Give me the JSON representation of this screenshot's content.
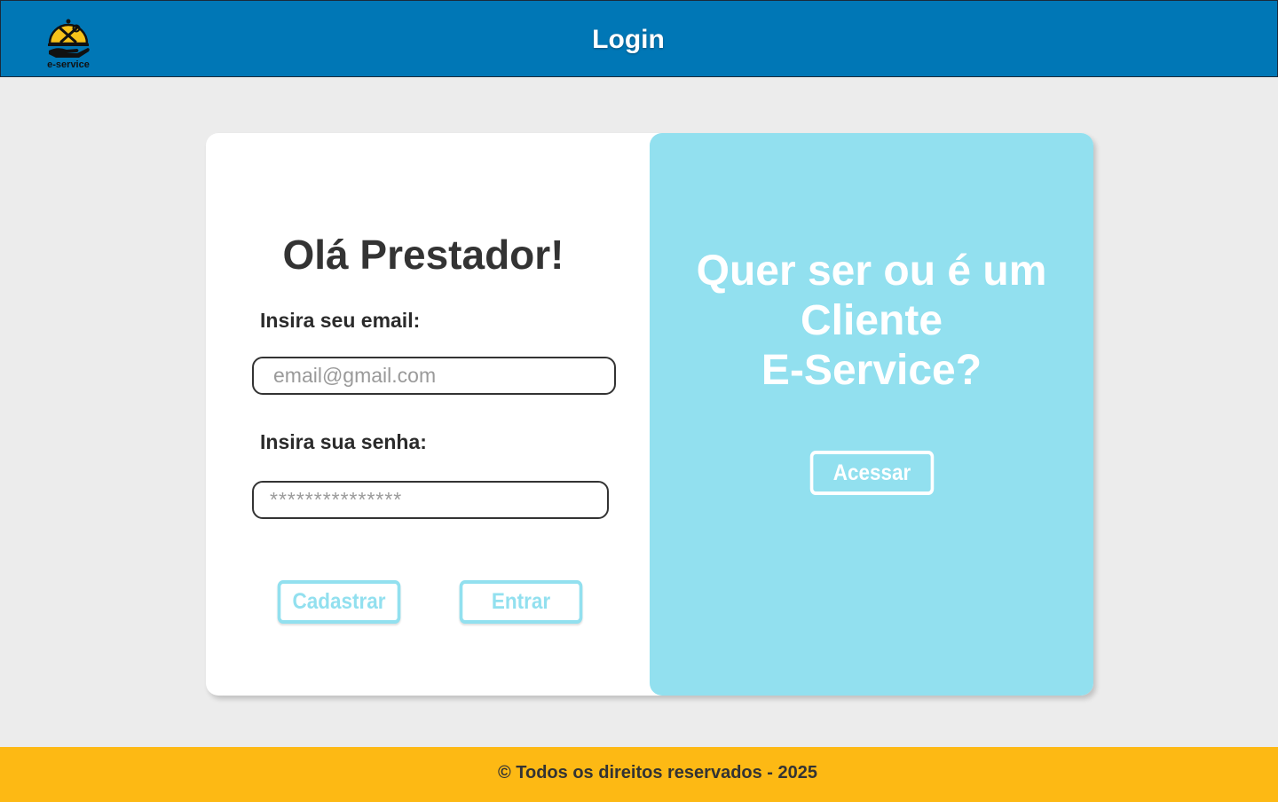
{
  "header": {
    "title": "Login",
    "logo_text": "e-service",
    "logo_icon": "tools-in-hand-icon"
  },
  "login": {
    "greeting": "Olá Prestador!",
    "email_label": "Insira seu email:",
    "email_placeholder": "email@gmail.com",
    "password_label": "Insira sua senha:",
    "password_placeholder": "***************",
    "register_button": "Cadastrar",
    "login_button": "Entrar"
  },
  "promo": {
    "line1": "Quer ser ou é um",
    "line2": "Cliente",
    "line3": "E-Service?",
    "access_button": "Acessar"
  },
  "footer": {
    "text": "© Todos os direitos reservados - 2025"
  },
  "colors": {
    "header": "#0077b6",
    "accent": "#92e0ef",
    "footer": "#fdb914",
    "background": "#ececec"
  }
}
